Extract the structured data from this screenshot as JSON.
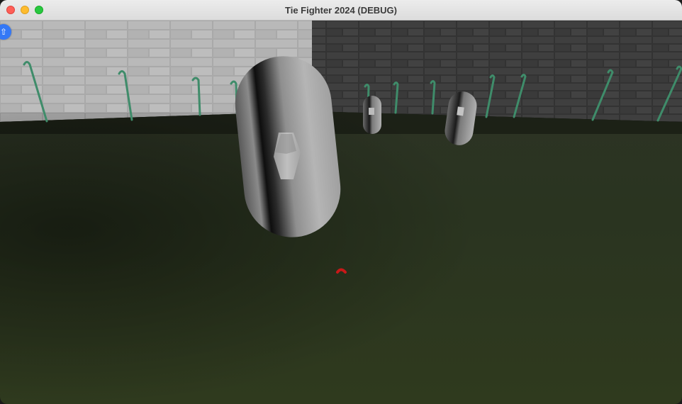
{
  "window": {
    "title": "Tie Fighter 2024 (DEBUG)"
  },
  "icons": {
    "close": "close-icon",
    "minimize": "minimize-icon",
    "maximize": "maximize-icon",
    "corner_badge": "accessibility-overlay-icon"
  },
  "colors": {
    "close": "#fe5f57",
    "minimize": "#febc2e",
    "maximize": "#28c840",
    "crosshair": "#c81818",
    "badge": "#3478f6"
  }
}
